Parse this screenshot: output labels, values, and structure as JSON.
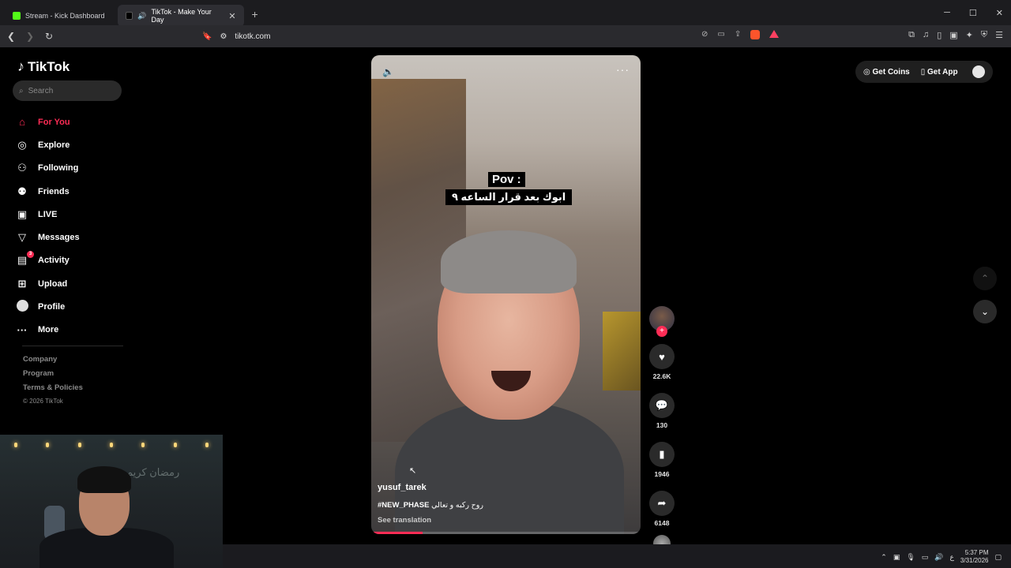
{
  "browser": {
    "tabs": [
      {
        "title": "Stream - Kick Dashboard",
        "active": false
      },
      {
        "title": "TikTok - Make Your Day",
        "active": true
      }
    ],
    "url": "tikotk.com"
  },
  "tiktok": {
    "logo": "TikTok",
    "search_placeholder": "Search",
    "menu": [
      {
        "label": "For You",
        "icon": "home-icon",
        "active": true
      },
      {
        "label": "Explore",
        "icon": "compass-icon",
        "active": false
      },
      {
        "label": "Following",
        "icon": "following-icon",
        "active": false
      },
      {
        "label": "Friends",
        "icon": "friends-icon",
        "active": false
      },
      {
        "label": "LIVE",
        "icon": "live-icon",
        "active": false
      },
      {
        "label": "Messages",
        "icon": "messages-icon",
        "active": false
      },
      {
        "label": "Activity",
        "icon": "activity-icon",
        "active": false,
        "badge": "3"
      },
      {
        "label": "Upload",
        "icon": "upload-icon",
        "active": false
      },
      {
        "label": "Profile",
        "icon": "profile-avatar",
        "active": false
      },
      {
        "label": "More",
        "icon": "more-icon",
        "active": false
      }
    ],
    "footer": {
      "company": "Company",
      "program": "Program",
      "terms": "Terms & Policies",
      "copyright": "© 2026 TikTok"
    },
    "header": {
      "get_coins": "Get Coins",
      "get_app": "Get App"
    },
    "video": {
      "caption_line1": "Pov :",
      "caption_line2": "ابوك بعد قرار الساعه ٩",
      "username": "yusuf_tarek",
      "hashtag": "#NEW_PHASE",
      "description_ar": "روح ركبه و تعالي",
      "see_translation": "See translation",
      "progress_fraction": 0.19
    },
    "actions": {
      "likes": "22.6K",
      "comments": "130",
      "saves": "1946",
      "shares": "6148"
    }
  },
  "webcam": {
    "wall_text": "رمضان كريم"
  },
  "taskbar": {
    "time": "5:37 PM",
    "date": "3/31/2026",
    "lang": "ع"
  },
  "colors": {
    "accent": "#fe2c55",
    "kick_green": "#53fc18"
  }
}
